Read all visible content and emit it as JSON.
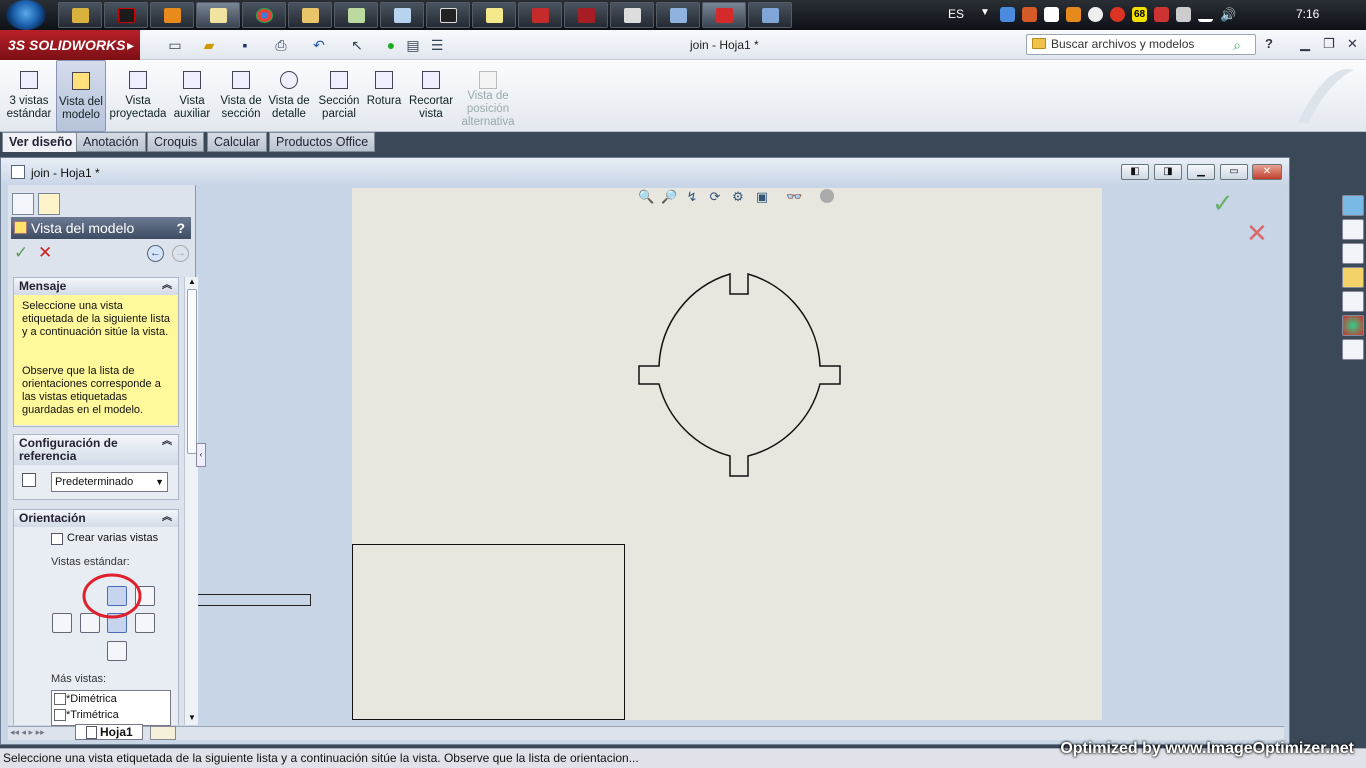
{
  "taskbar": {
    "language": "ES",
    "clock": "7:16",
    "badge_count": "68",
    "apps": [
      "explorer",
      "nero",
      "media-player",
      "notepad-n",
      "chrome",
      "file-explorer",
      "pictures",
      "notes",
      "inkscape",
      "sticky",
      "autocad",
      "solidworks-red",
      "cad",
      "window",
      "solidworks",
      "paint"
    ]
  },
  "titlebar": {
    "brand": "SOLIDWORKS",
    "brand_prefix": "3S",
    "document_title": "join - Hoja1 *",
    "search_placeholder": "Buscar archivos y modelos",
    "help": "?"
  },
  "commands": [
    {
      "label_1": "3 vistas",
      "label_2": "estándar",
      "icon": "three-views-icon"
    },
    {
      "label_1": "Vista del",
      "label_2": "modelo",
      "icon": "model-view-icon",
      "active": true
    },
    {
      "label_1": "Vista",
      "label_2": "proyectada",
      "icon": "projected-view-icon"
    },
    {
      "label_1": "Vista",
      "label_2": "auxiliar",
      "icon": "auxiliary-view-icon"
    },
    {
      "label_1": "Vista de",
      "label_2": "sección",
      "icon": "section-view-icon"
    },
    {
      "label_1": "Vista de",
      "label_2": "detalle",
      "icon": "detail-view-icon"
    },
    {
      "label_1": "Sección",
      "label_2": "parcial",
      "icon": "broken-out-section-icon"
    },
    {
      "label_1": "Rotura",
      "label_2": "",
      "icon": "break-icon"
    },
    {
      "label_1": "Recortar",
      "label_2": "vista",
      "icon": "crop-view-icon"
    },
    {
      "label_1": "Vista de",
      "label_2": "posición",
      "label_3": "alternativa",
      "icon": "alternate-position-icon",
      "disabled": true
    }
  ],
  "tabs": [
    "Ver diseño",
    "Anotación",
    "Croquis",
    "Calcular",
    "Productos Office"
  ],
  "docwindow": {
    "title": "join - Hoja1 *"
  },
  "property_manager": {
    "title": "Vista del modelo",
    "help": "?",
    "message_header": "Mensaje",
    "message_p1": "Seleccione una vista etiquetada de la siguiente lista y a continuación sitúe la vista.",
    "message_p2": "Observe que la lista de orientaciones corresponde a las vistas etiquetadas guardadas en el modelo.",
    "config_header": "Configuración de referencia",
    "config_value": "Predeterminado",
    "orientation_header": "Orientación",
    "create_multiple": "Crear varias vistas",
    "standard_views": "Vistas estándar:",
    "more_views": "Más vistas:",
    "more_views_list": [
      "*Dimétrica",
      "*Trimétrica"
    ]
  },
  "sheet_tab": "Hoja1",
  "status_text": "Seleccione una vista etiquetada de la siguiente lista y a continuación sitúe la vista.   Observe que la lista de orientacion...",
  "watermark": "Optimized by www.ImageOptimizer.net",
  "colors": {
    "brand_red": "#b8202a",
    "message_yellow": "#fff99b",
    "sheet": "#e8e7df",
    "highlight_circle": "#e0202a"
  }
}
